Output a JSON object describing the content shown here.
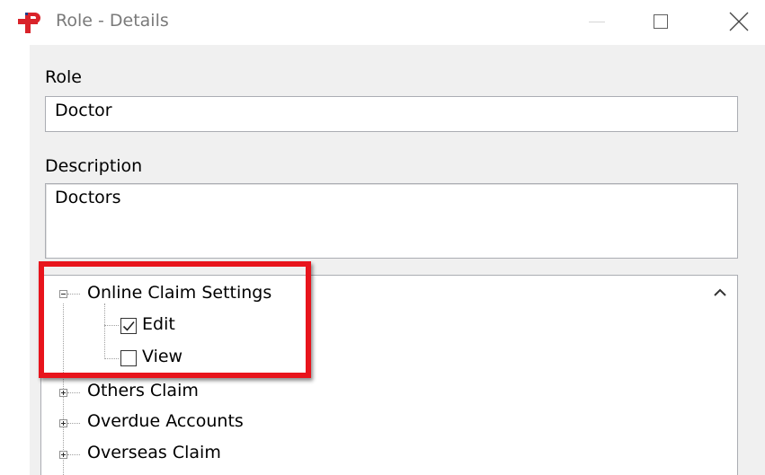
{
  "window": {
    "title": "Role - Details"
  },
  "form": {
    "role_label": "Role",
    "role_value": "Doctor",
    "description_label": "Description",
    "description_value": "Doctors"
  },
  "tree": {
    "items": [
      {
        "label": "Online Claim Settings",
        "expanded": true,
        "children": [
          {
            "label": "Edit",
            "checked": true
          },
          {
            "label": "View",
            "checked": false
          }
        ]
      },
      {
        "label": "Others Claim",
        "expanded": false
      },
      {
        "label": "Overdue Accounts",
        "expanded": false
      },
      {
        "label": "Overseas Claim",
        "expanded": false
      }
    ]
  },
  "colors": {
    "highlight": "#e8141c",
    "brand": "#d9232a",
    "brand_accent": "#1f3c8c"
  }
}
